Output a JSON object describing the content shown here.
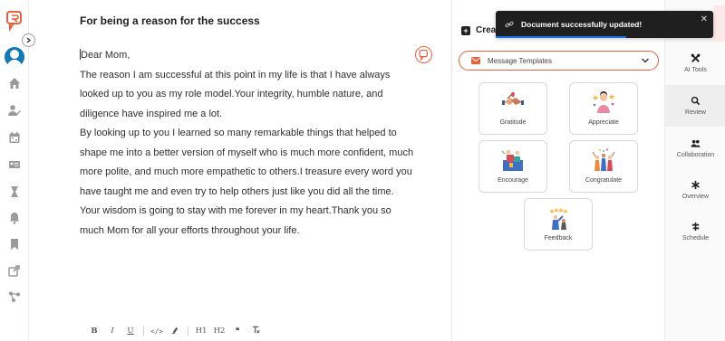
{
  "document": {
    "title": "For being a reason for the success",
    "greeting": "Dear Mom,",
    "paragraphs": [
      "The reason I am successful at this point in my life is that I have always looked up to you as my role model.Your integrity, humble nature, and diligence have inspired me a lot.",
      "By looking up to you I learned so many remarkable things that helped to shape me into a better version of myself who is much more confident, much more polite, and much more empathetic to others.I treasure every word you have taught me and even try to help others just like you did all the time.",
      "Your wisdom is going to stay with me forever in my heart.Thank you so much Mom for all your efforts throughout your life."
    ]
  },
  "format_toolbar": {
    "bold": "B",
    "italic": "I",
    "underline": "U",
    "code": "</>",
    "highlight_icon": "highlighter-icon",
    "h1": "H1",
    "h2": "H2",
    "quote": "❝",
    "clear_format_icon": "clear-format-icon"
  },
  "templates_panel": {
    "heading": "Crea",
    "select_label": "Message Templates",
    "cards": [
      {
        "label": "Gratitude"
      },
      {
        "label": "Appreciate"
      },
      {
        "label": "Encourage"
      },
      {
        "label": "Congratulate"
      },
      {
        "label": "Feedback"
      }
    ]
  },
  "tools": [
    {
      "label": "AI Tools",
      "icon": "tools-icon",
      "active": false
    },
    {
      "label": "Review",
      "icon": "search-icon",
      "active": true
    },
    {
      "label": "Collaboration",
      "icon": "users-icon",
      "active": false
    },
    {
      "label": "Overview",
      "icon": "asterisk-icon",
      "active": false
    },
    {
      "label": "Schedule",
      "icon": "schedule-icon",
      "active": false
    }
  ],
  "toast": {
    "message": "Document successfully updated!",
    "progress_fraction": 0.6
  },
  "colors": {
    "brand": "#e8603c",
    "avatar": "#1478b8",
    "toast_bg": "#1f1f1f",
    "toast_progress": "#1a73e8"
  }
}
